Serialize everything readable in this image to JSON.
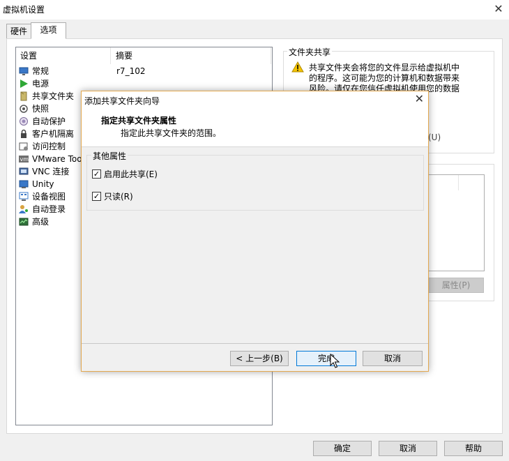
{
  "window": {
    "title": "虚拟机设置",
    "close": "✕"
  },
  "tabs": [
    {
      "label": "硬件"
    },
    {
      "label": "选项"
    }
  ],
  "settings_list": {
    "headers": {
      "setting": "设置",
      "summary": "摘要"
    },
    "items": [
      {
        "label": "常规",
        "summary": "r7_102",
        "icon": "monitor-icon"
      },
      {
        "label": "电源",
        "summary": "",
        "icon": "play-icon"
      },
      {
        "label": "共享文件夹",
        "summary": "",
        "icon": "shared-folder-icon"
      },
      {
        "label": "快照",
        "summary": "",
        "icon": "snapshot-icon"
      },
      {
        "label": "自动保护",
        "summary": "",
        "icon": "autoprotect-icon"
      },
      {
        "label": "客户机隔离",
        "summary": "",
        "icon": "lock-icon"
      },
      {
        "label": "访问控制",
        "summary": "",
        "icon": "access-control-icon"
      },
      {
        "label": "VMware Too",
        "summary": "",
        "icon": "vmware-tools-icon"
      },
      {
        "label": "VNC 连接",
        "summary": "",
        "icon": "vnc-icon"
      },
      {
        "label": "Unity",
        "summary": "",
        "icon": "unity-icon"
      },
      {
        "label": "设备视图",
        "summary": "",
        "icon": "device-view-icon"
      },
      {
        "label": "自动登录",
        "summary": "",
        "icon": "autologin-icon"
      },
      {
        "label": "高级",
        "summary": "",
        "icon": "advanced-icon"
      }
    ]
  },
  "shared_folders": {
    "group_title": "文件夹共享",
    "warning_lines": [
      "共享文件夹会将您的文件显示给虚拟机中",
      "的程序。这可能为您的计算机和数据带来",
      "风险。请仅在您信任虚拟机使用您的数据"
    ],
    "option_suffix": "(U)",
    "properties_button": "属性(P)"
  },
  "footer": {
    "ok": "确定",
    "cancel": "取消",
    "help": "帮助"
  },
  "wizard": {
    "title": "添加共享文件夹向导",
    "close": "✕",
    "heading": "指定共享文件夹属性",
    "subheading": "指定此共享文件夹的范围。",
    "group_title": "其他属性",
    "options": [
      {
        "label": "启用此共享(E)",
        "checked": true
      },
      {
        "label": "只读(R)",
        "checked": true
      }
    ],
    "back_button": "< 上一步(B)",
    "finish_button": "完成",
    "cancel_button": "取消",
    "checkmark": "✓"
  },
  "colors": {
    "accent": "#0078d7",
    "wizard_border": "#e3a84f",
    "warning": "#f5c400",
    "power_green": "#2fa836"
  }
}
